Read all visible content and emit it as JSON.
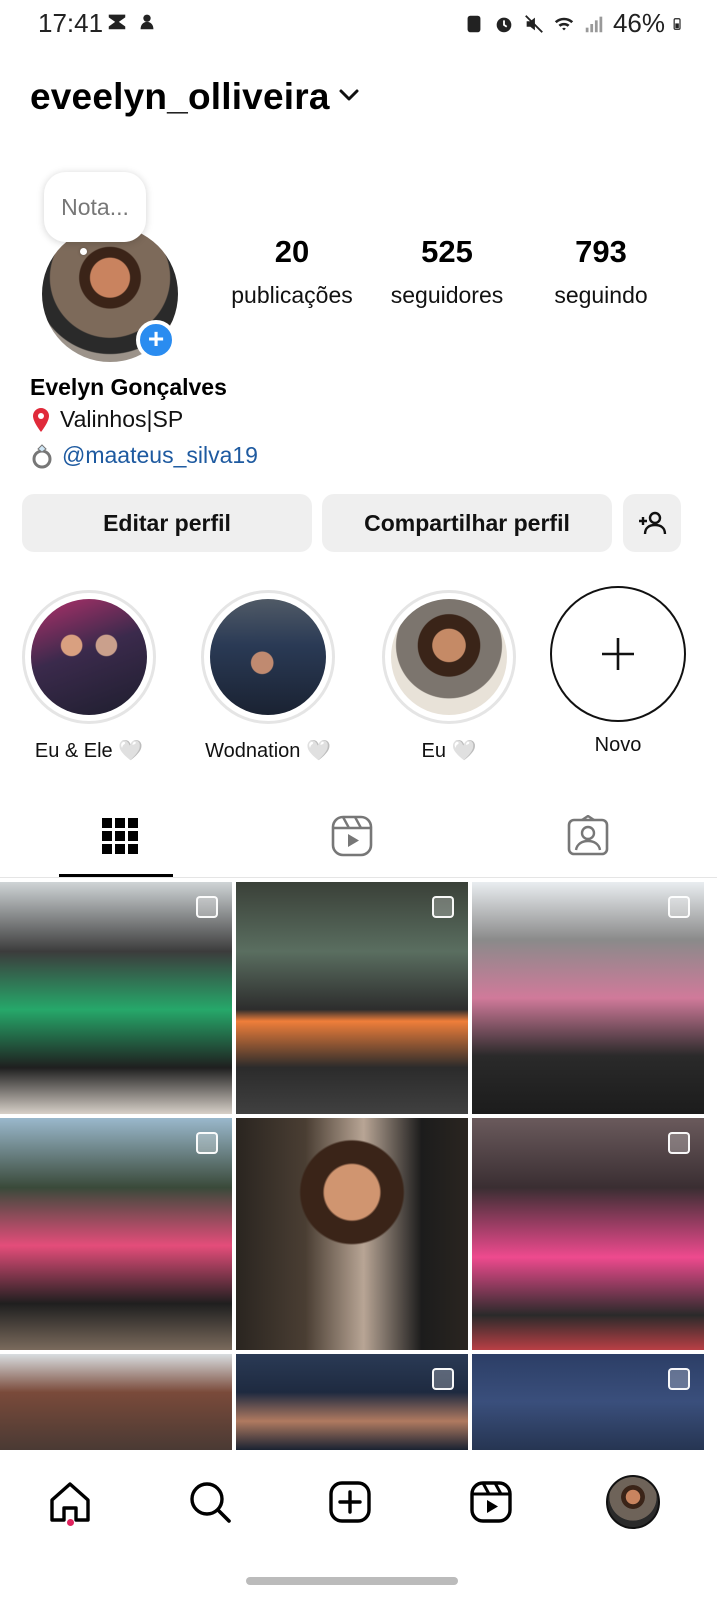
{
  "status_bar": {
    "time": "17:41",
    "battery": "46%"
  },
  "header": {
    "username": "eveelyn_olliveira"
  },
  "note": {
    "placeholder": "Nota..."
  },
  "stats": [
    {
      "count": "20",
      "label": "publicações"
    },
    {
      "count": "525",
      "label": "seguidores"
    },
    {
      "count": "793",
      "label": "seguindo"
    }
  ],
  "bio": {
    "name": "Evelyn Gonçalves",
    "location": "Valinhos|SP",
    "partner": "@maateus_silva19"
  },
  "actions": {
    "edit": "Editar perfil",
    "share": "Compartilhar perfil"
  },
  "highlights": [
    {
      "label": "Eu & Ele 🤍"
    },
    {
      "label": "Wodnation 🤍"
    },
    {
      "label": "Eu 🤍"
    },
    {
      "label": "Novo"
    }
  ],
  "tabs": [
    "grid-icon",
    "reels-icon",
    "tagged-icon"
  ],
  "colors": {
    "accent_blue": "#2a8cf0",
    "link_blue": "#1e5aa0",
    "button_bg": "#efefef",
    "notification_dot": "#e0245e"
  },
  "bottom_nav": [
    "home-icon",
    "search-icon",
    "create-icon",
    "reels-icon",
    "profile-avatar"
  ]
}
